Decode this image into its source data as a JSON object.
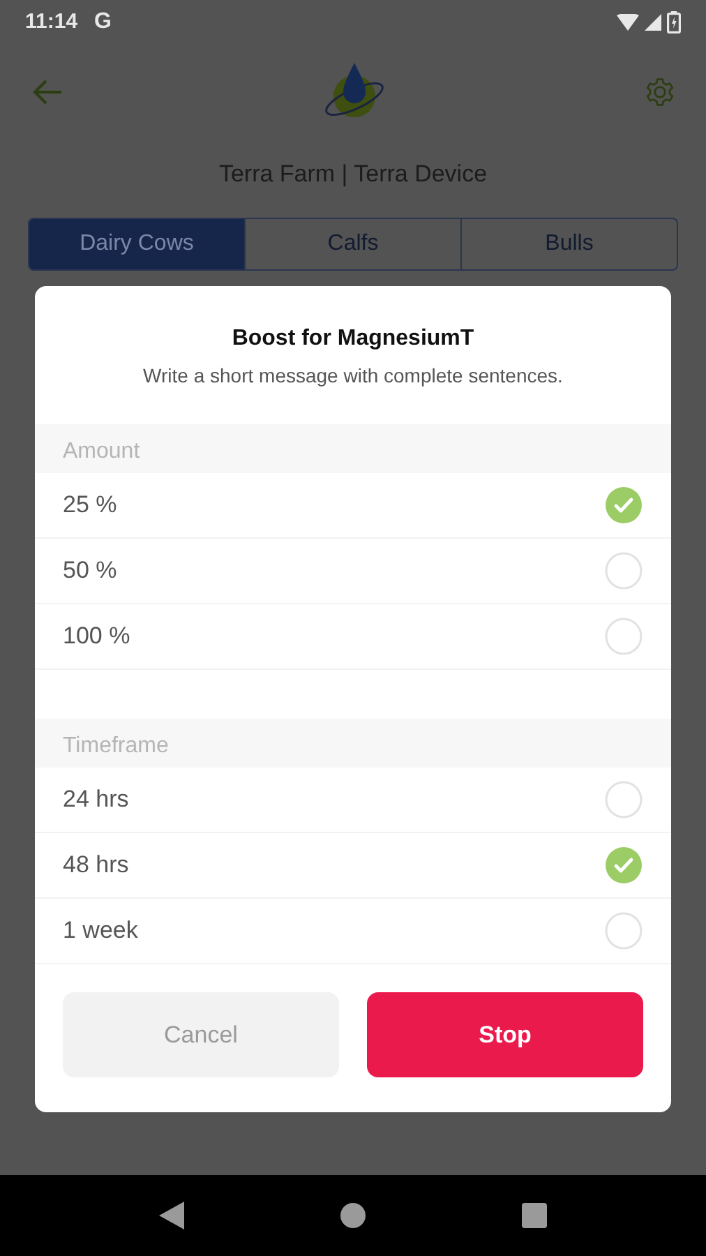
{
  "status_bar": {
    "time": "11:14",
    "notification": "G"
  },
  "header": {
    "title": "Terra Farm | Terra Device"
  },
  "tabs": [
    {
      "label": "Dairy Cows",
      "selected": true
    },
    {
      "label": "Calfs",
      "selected": false
    },
    {
      "label": "Bulls",
      "selected": false
    }
  ],
  "dialog": {
    "title": "Boost for MagnesiumT",
    "subtitle": "Write a short message with complete sentences.",
    "sections": [
      {
        "title": "Amount",
        "options": [
          {
            "label": "25 %",
            "selected": true
          },
          {
            "label": "50 %",
            "selected": false
          },
          {
            "label": "100 %",
            "selected": false
          }
        ]
      },
      {
        "title": "Timeframe",
        "options": [
          {
            "label": "24 hrs",
            "selected": false
          },
          {
            "label": "48 hrs",
            "selected": true
          },
          {
            "label": "1 week",
            "selected": false
          }
        ]
      }
    ],
    "buttons": [
      {
        "label": "Cancel",
        "kind": "secondary"
      },
      {
        "label": "Stop",
        "kind": "primary"
      }
    ]
  }
}
